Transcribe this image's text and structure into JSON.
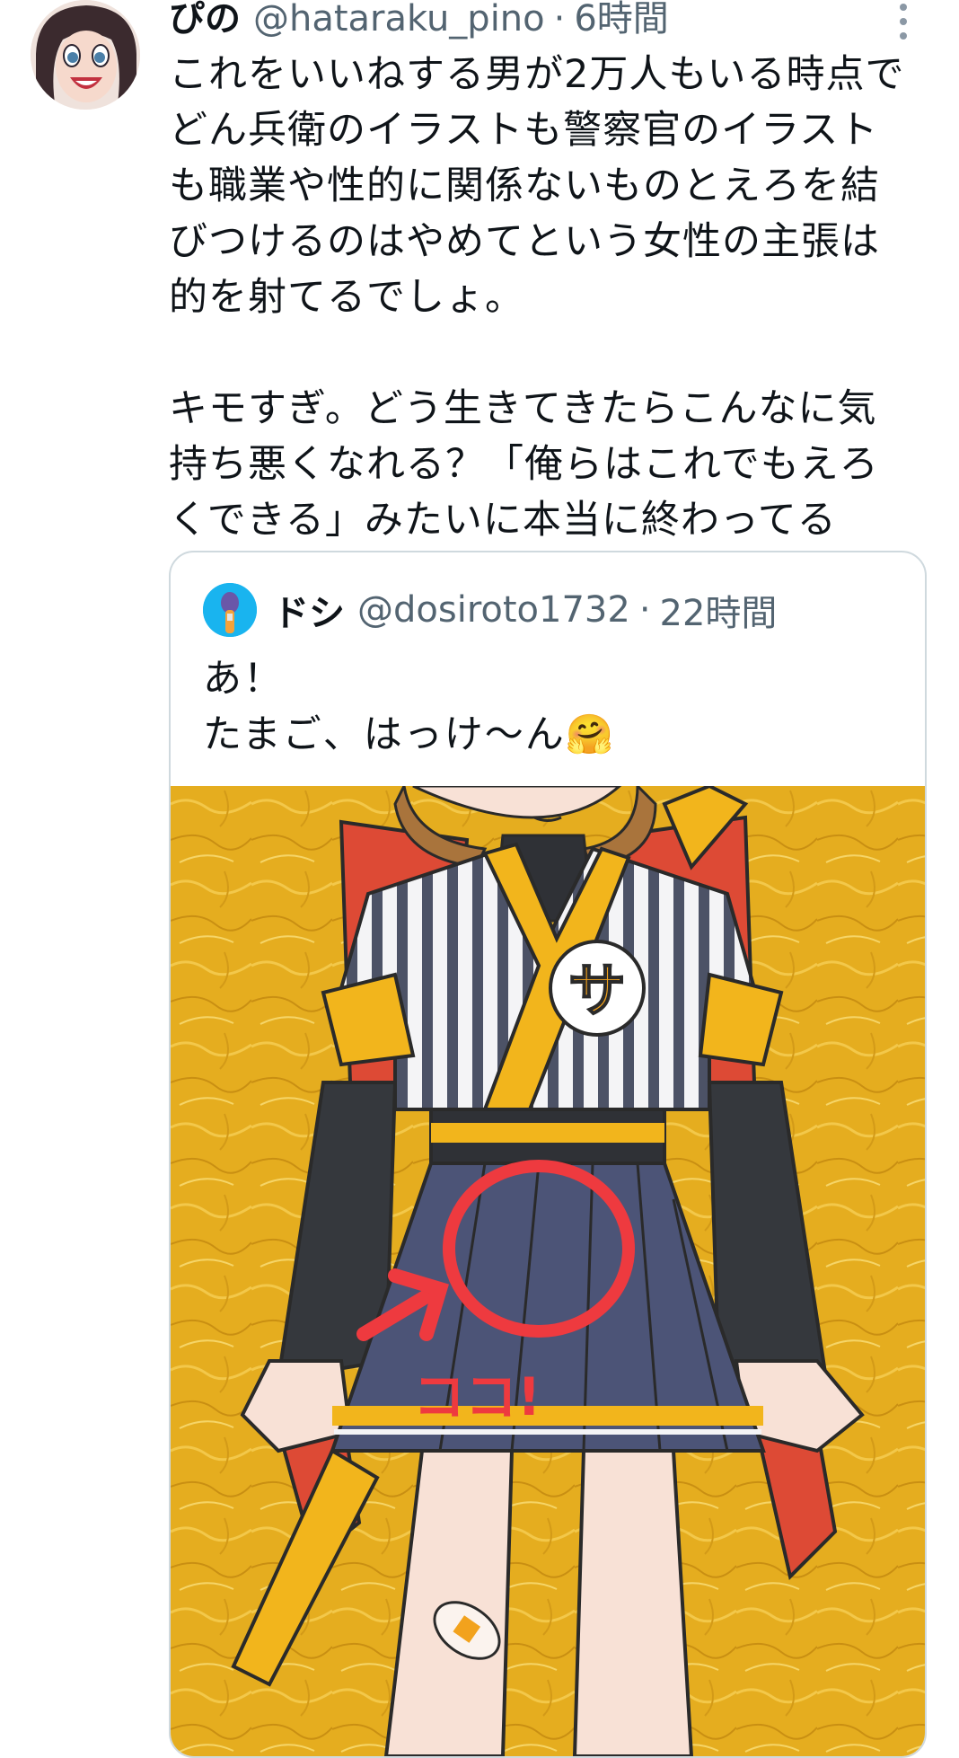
{
  "tweet": {
    "display_name": "ぴの",
    "handle": "@hataraku_pino",
    "separator": "·",
    "time": "6時間",
    "text": "これをいいねする男が2万人もいる時点で\nどん兵衛のイラストも警察官のイラスト\nも職業や性的に関係ないものとえろを結\nびつけるのはやめてという女性の主張は\n的を射てるでしょ。\n\nキモすぎ。どう生きてきたらこんなに気\n持ち悪くなれる？「俺らはこれでもえろ\nくできる」みたいに本当に終わってる",
    "more_icon": "vertical-ellipsis"
  },
  "quoted_tweet": {
    "display_name": "ドシ",
    "handle": "@dosiroto1732",
    "separator": "·",
    "time": "22時間",
    "text": "あ！\nたまご、はっけ〜ん🤗",
    "image": {
      "annotation_text": "ココ!",
      "badge_text": "サ"
    }
  },
  "colors": {
    "text_primary": "#0f1419",
    "text_secondary": "#536471",
    "border": "#cfd9de",
    "gold_background": "#e5ad1f",
    "annotation_red": "#ee3a3f"
  }
}
